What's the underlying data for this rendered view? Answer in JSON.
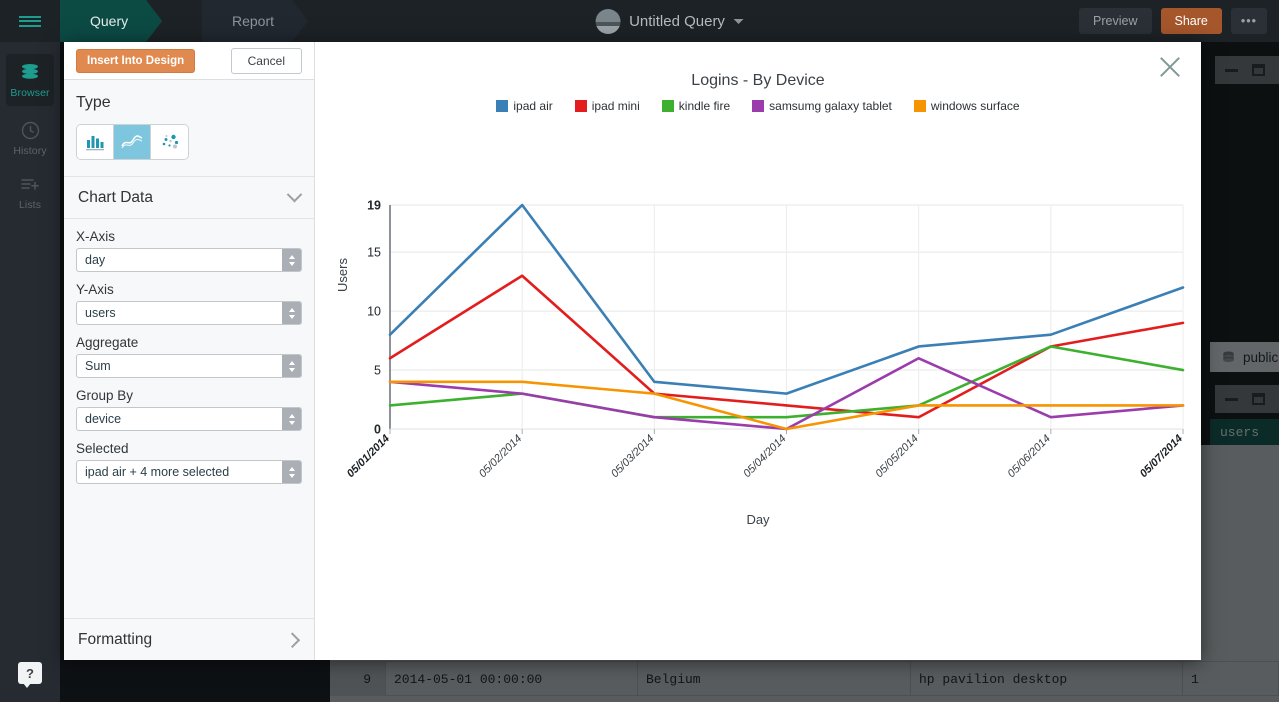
{
  "rail": {
    "menu_icon": "hamburger-icon",
    "items": [
      {
        "label": "Browser",
        "icon": "database-icon",
        "active": true
      },
      {
        "label": "History",
        "icon": "clock-icon",
        "active": false
      },
      {
        "label": "Lists",
        "icon": "list-add-icon",
        "active": false
      }
    ],
    "help_label": "?"
  },
  "topbar": {
    "tabs": [
      {
        "label": "Query",
        "active": true
      },
      {
        "label": "Report",
        "active": false
      }
    ],
    "title": "Untitled Query",
    "caret_icon": "chevron-down-icon",
    "avatar_icon": "avatar",
    "preview_label": "Preview",
    "share_label": "Share",
    "more_label": "•••"
  },
  "background": {
    "schema_label": "public",
    "schema_icon": "database-icon",
    "table_label": "users",
    "minimize_icon": "minimize-icon",
    "maximize_icon": "maximize-icon",
    "grid_row": {
      "num": "9",
      "timestamp": "2014-05-01 00:00:00",
      "country": "Belgium",
      "device": "hp pavilion desktop",
      "count": "1"
    }
  },
  "modal": {
    "close_icon": "close-icon",
    "insert_label": "Insert Into Design",
    "cancel_label": "Cancel",
    "type_section_title": "Type",
    "type_options": [
      {
        "name": "bar-chart",
        "selected": false
      },
      {
        "name": "line-chart",
        "selected": true
      },
      {
        "name": "scatter-chart",
        "selected": false
      }
    ],
    "chart_data_label": "Chart Data",
    "chart_data_expanded": true,
    "formatting_label": "Formatting",
    "formatting_expanded": false,
    "fields": [
      {
        "label": "X-Axis",
        "value": "day",
        "name": "x-axis-select"
      },
      {
        "label": "Y-Axis",
        "value": "users",
        "name": "y-axis-select"
      },
      {
        "label": "Aggregate",
        "value": "Sum",
        "name": "aggregate-select"
      },
      {
        "label": "Group By",
        "value": "device",
        "name": "group-by-select"
      },
      {
        "label": "Selected",
        "value": "ipad air + 4 more selected",
        "name": "selected-series-select"
      }
    ]
  },
  "chart_data": {
    "type": "line",
    "title": "Logins - By Device",
    "xlabel": "Day",
    "ylabel": "Users",
    "grid": true,
    "legend_position": "top",
    "categories": [
      "05/01/2014",
      "05/02/2014",
      "05/03/2014",
      "05/04/2014",
      "05/05/2014",
      "05/06/2014",
      "05/07/2014"
    ],
    "bold_categories": [
      "05/01/2014",
      "05/07/2014"
    ],
    "yticks": [
      0,
      5,
      10,
      15,
      19
    ],
    "ylim": [
      0,
      19
    ],
    "bold_yticks": [
      0,
      19
    ],
    "series": [
      {
        "name": "ipad air",
        "color": "#3a7fb5",
        "values": [
          8,
          19,
          4,
          3,
          7,
          8,
          12
        ]
      },
      {
        "name": "ipad mini",
        "color": "#e31d1d",
        "values": [
          6,
          13,
          3,
          2,
          1,
          7,
          9
        ]
      },
      {
        "name": "kindle fire",
        "color": "#3db02f",
        "values": [
          2,
          3,
          1,
          1,
          2,
          7,
          5
        ]
      },
      {
        "name": "samsumg galaxy tablet",
        "color": "#9b3cad",
        "values": [
          4,
          3,
          1,
          0,
          6,
          1,
          2
        ]
      },
      {
        "name": "windows surface",
        "color": "#f79401",
        "values": [
          4,
          4,
          3,
          0,
          2,
          2,
          2
        ]
      }
    ]
  }
}
